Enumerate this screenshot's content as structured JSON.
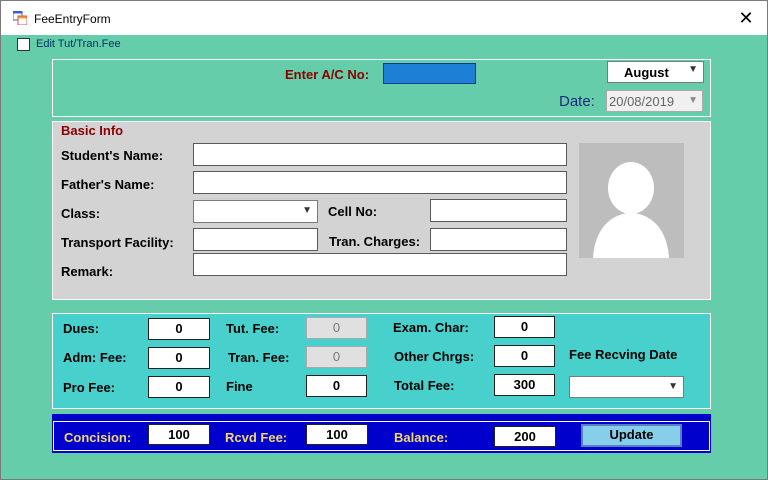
{
  "window": {
    "title": "FeeEntryForm",
    "close_glyph": "✕"
  },
  "edit_checkbox": {
    "label": "Edit Tut/Tran.Fee",
    "checked": false
  },
  "top": {
    "account_label": "Enter A/C No:",
    "account_value": "",
    "month_value": "August",
    "date_label": "Date:",
    "date_value": "20/08/2019"
  },
  "basic_info": {
    "title": "Basic Info",
    "students_name_label": "Student's Name:",
    "fathers_name_label": "Father's Name:",
    "class_label": "Class:",
    "cell_label": "Cell No:",
    "transport_label": "Transport Facility:",
    "tran_charges_label": "Tran. Charges:",
    "remark_label": "Remark:"
  },
  "fees": {
    "dues_label": "Dues:",
    "dues_value": "0",
    "adm_label": "Adm: Fee:",
    "adm_value": "0",
    "pro_label": "Pro Fee:",
    "pro_value": "0",
    "tut_label": "Tut. Fee:",
    "tut_value": "0",
    "tran_label": "Tran. Fee:",
    "tran_value": "0",
    "fine_label": "Fine",
    "fine_value": "0",
    "exam_label": "Exam. Char:",
    "exam_value": "0",
    "other_label": "Other Chrgs:",
    "other_value": "0",
    "total_label": "Total Fee:",
    "total_value": "300",
    "recv_date_label": "Fee Recving Date"
  },
  "summary": {
    "concision_label": "Concision:",
    "concision_value": "100",
    "rcvd_label": "Rcvd Fee:",
    "rcvd_value": "100",
    "balance_label": "Balance:",
    "balance_value": "200",
    "update_label": "Update"
  },
  "colors": {
    "form_bg": "#66cdaa",
    "basic_bg": "#d3d3d3",
    "fee_bg": "#48d1cc",
    "summary_bg": "#0000cd",
    "account_input": "#1e7fd6"
  },
  "icons": [
    "form-icon",
    "close-icon",
    "chevron-down-icon",
    "avatar-placeholder-icon"
  ]
}
